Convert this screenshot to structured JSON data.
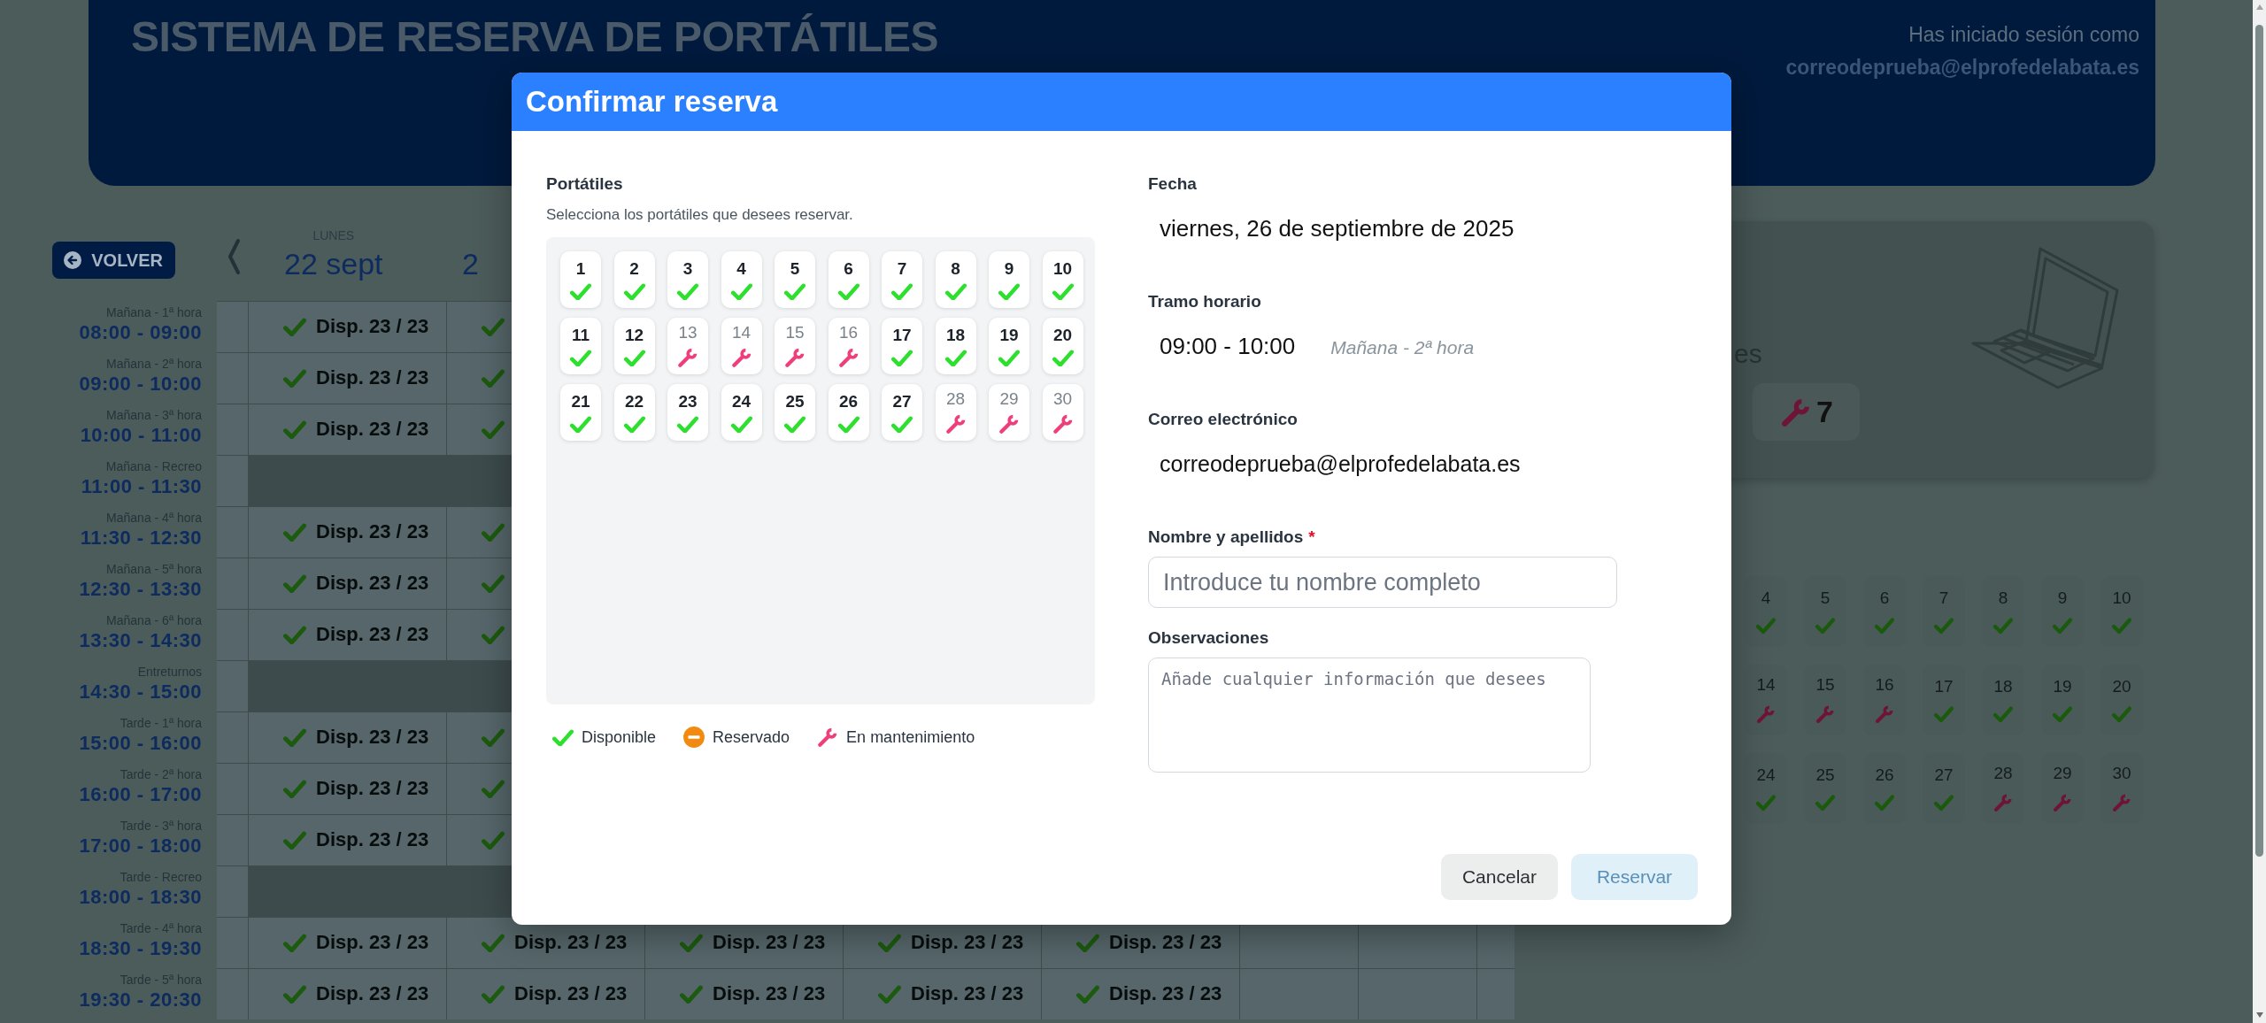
{
  "header": {
    "title": "SISTEMA DE RESERVA DE PORTÁTILES",
    "session_label": "Has iniciado sesión como",
    "session_email": "correodeprueba@elprofedelabata.es"
  },
  "schedule": {
    "back_button": "VOLVER",
    "days": [
      {
        "weekday": "LUNES",
        "date": "22 sept"
      },
      {
        "date": "2"
      }
    ],
    "rows": [
      {
        "shift": "Mañana - 1ª hora",
        "time": "08:00 - 09:00",
        "kind": "slot",
        "cells": [
          {
            "kind": "available",
            "text": "Disp. 23 / 23"
          },
          {
            "kind": "available"
          }
        ]
      },
      {
        "shift": "Mañana - 2ª hora",
        "time": "09:00 - 10:00",
        "kind": "slot",
        "cells": [
          {
            "kind": "available",
            "text": "Disp. 23 / 23"
          },
          {
            "kind": "available"
          }
        ]
      },
      {
        "shift": "Mañana - 3ª hora",
        "time": "10:00 - 11:00",
        "kind": "slot",
        "cells": [
          {
            "kind": "available",
            "text": "Disp. 23 / 23"
          },
          {
            "kind": "available"
          }
        ]
      },
      {
        "shift": "Mañana - Recreo",
        "time": "11:00 - 11:30",
        "kind": "break"
      },
      {
        "shift": "Mañana - 4ª hora",
        "time": "11:30 - 12:30",
        "kind": "slot",
        "cells": [
          {
            "kind": "available",
            "text": "Disp. 23 / 23"
          },
          {
            "kind": "available"
          }
        ]
      },
      {
        "shift": "Mañana - 5ª hora",
        "time": "12:30 - 13:30",
        "kind": "slot",
        "cells": [
          {
            "kind": "available",
            "text": "Disp. 23 / 23"
          },
          {
            "kind": "available"
          }
        ]
      },
      {
        "shift": "Mañana - 6ª hora",
        "time": "13:30 - 14:30",
        "kind": "slot",
        "cells": [
          {
            "kind": "available",
            "text": "Disp. 23 / 23"
          },
          {
            "kind": "available"
          }
        ]
      },
      {
        "shift": "Entreturnos",
        "time": "14:30 - 15:00",
        "kind": "break"
      },
      {
        "shift": "Tarde - 1ª hora",
        "time": "15:00 - 16:00",
        "kind": "slot",
        "cells": [
          {
            "kind": "available",
            "text": "Disp. 23 / 23"
          },
          {
            "kind": "available"
          }
        ]
      },
      {
        "shift": "Tarde - 2ª hora",
        "time": "16:00 - 17:00",
        "kind": "slot",
        "cells": [
          {
            "kind": "available",
            "text": "Disp. 23 / 23"
          },
          {
            "kind": "available"
          }
        ]
      },
      {
        "shift": "Tarde - 3ª hora",
        "time": "17:00 - 18:00",
        "kind": "slot",
        "cells": [
          {
            "kind": "available",
            "text": "Disp. 23 / 23"
          },
          {
            "kind": "available"
          }
        ]
      },
      {
        "shift": "Tarde - Recreo",
        "time": "18:00 - 18:30",
        "kind": "break"
      },
      {
        "shift": "Tarde - 4ª hora",
        "time": "18:30 - 19:30",
        "kind": "slot",
        "cells": [
          {
            "kind": "available",
            "text": "Disp. 23 / 23"
          },
          {
            "kind": "available",
            "text": "Disp. 23 / 23"
          },
          {
            "kind": "available",
            "text": "Disp. 23 / 23"
          },
          {
            "kind": "available",
            "text": "Disp. 23 / 23"
          },
          {
            "kind": "available",
            "text": "Disp. 23 / 23"
          }
        ]
      },
      {
        "shift": "Tarde - 5ª hora",
        "time": "19:30 - 20:30",
        "kind": "slot",
        "cells": [
          {
            "kind": "available",
            "text": "Disp. 23 / 23"
          },
          {
            "kind": "available",
            "text": "Disp. 23 / 23"
          },
          {
            "kind": "available",
            "text": "Disp. 23 / 23"
          },
          {
            "kind": "available",
            "text": "Disp. 23 / 23"
          },
          {
            "kind": "available",
            "text": "Disp. 23 / 23"
          }
        ]
      }
    ]
  },
  "side": {
    "summary_text": "es",
    "maintenance_count": "7",
    "laptops": [
      {
        "number": "4",
        "kind": "available"
      },
      {
        "number": "5",
        "kind": "available"
      },
      {
        "number": "6",
        "kind": "available"
      },
      {
        "number": "7",
        "kind": "available"
      },
      {
        "number": "8",
        "kind": "available"
      },
      {
        "number": "9",
        "kind": "available"
      },
      {
        "number": "10",
        "kind": "available"
      },
      {
        "number": "14",
        "kind": "maintenance"
      },
      {
        "number": "15",
        "kind": "maintenance"
      },
      {
        "number": "16",
        "kind": "maintenance"
      },
      {
        "number": "17",
        "kind": "available"
      },
      {
        "number": "18",
        "kind": "available"
      },
      {
        "number": "19",
        "kind": "available"
      },
      {
        "number": "20",
        "kind": "available"
      },
      {
        "number": "24",
        "kind": "available"
      },
      {
        "number": "25",
        "kind": "available"
      },
      {
        "number": "26",
        "kind": "available"
      },
      {
        "number": "27",
        "kind": "available"
      },
      {
        "number": "28",
        "kind": "maintenance"
      },
      {
        "number": "29",
        "kind": "maintenance"
      },
      {
        "number": "30",
        "kind": "maintenance"
      }
    ]
  },
  "modal": {
    "title": "Confirmar reserva",
    "laptops_label": "Portátiles",
    "laptops_hint": "Selecciona los portátiles que desees reservar.",
    "laptops": [
      {
        "number": "1",
        "kind": "available"
      },
      {
        "number": "2",
        "kind": "available"
      },
      {
        "number": "3",
        "kind": "available"
      },
      {
        "number": "4",
        "kind": "available"
      },
      {
        "number": "5",
        "kind": "available"
      },
      {
        "number": "6",
        "kind": "available"
      },
      {
        "number": "7",
        "kind": "available"
      },
      {
        "number": "8",
        "kind": "available"
      },
      {
        "number": "9",
        "kind": "available"
      },
      {
        "number": "10",
        "kind": "available"
      },
      {
        "number": "11",
        "kind": "available"
      },
      {
        "number": "12",
        "kind": "available"
      },
      {
        "number": "13",
        "kind": "maintenance"
      },
      {
        "number": "14",
        "kind": "maintenance"
      },
      {
        "number": "15",
        "kind": "maintenance"
      },
      {
        "number": "16",
        "kind": "maintenance"
      },
      {
        "number": "17",
        "kind": "available"
      },
      {
        "number": "18",
        "kind": "available"
      },
      {
        "number": "19",
        "kind": "available"
      },
      {
        "number": "20",
        "kind": "available"
      },
      {
        "number": "21",
        "kind": "available"
      },
      {
        "number": "22",
        "kind": "available"
      },
      {
        "number": "23",
        "kind": "available"
      },
      {
        "number": "24",
        "kind": "available"
      },
      {
        "number": "25",
        "kind": "available"
      },
      {
        "number": "26",
        "kind": "available"
      },
      {
        "number": "27",
        "kind": "available"
      },
      {
        "number": "28",
        "kind": "maintenance"
      },
      {
        "number": "29",
        "kind": "maintenance"
      },
      {
        "number": "30",
        "kind": "maintenance"
      }
    ],
    "legend": [
      {
        "kind": "available",
        "label": "Disponible"
      },
      {
        "kind": "reserved",
        "label": "Reservado"
      },
      {
        "kind": "maintenance",
        "label": "En mantenimiento"
      }
    ],
    "date_label": "Fecha",
    "date": "viernes, 26 de septiembre de 2025",
    "slot_label": "Tramo horario",
    "slot_time": "09:00 - 10:00",
    "slot_name": "Mañana - 2ª hora",
    "email_label": "Correo electrónico",
    "email": "correodeprueba@elprofedelabata.es",
    "name_label": "Nombre y apellidos",
    "required_mark": "*",
    "name_placeholder": "Introduce tu nombre completo",
    "notes_label": "Observaciones",
    "notes_placeholder": "Añade cualquier información que desees",
    "buttons": [
      {
        "label": "Cancelar",
        "kind": "secondary",
        "disabled": false
      },
      {
        "label": "Reservar",
        "kind": "primary",
        "disabled": true
      }
    ]
  }
}
